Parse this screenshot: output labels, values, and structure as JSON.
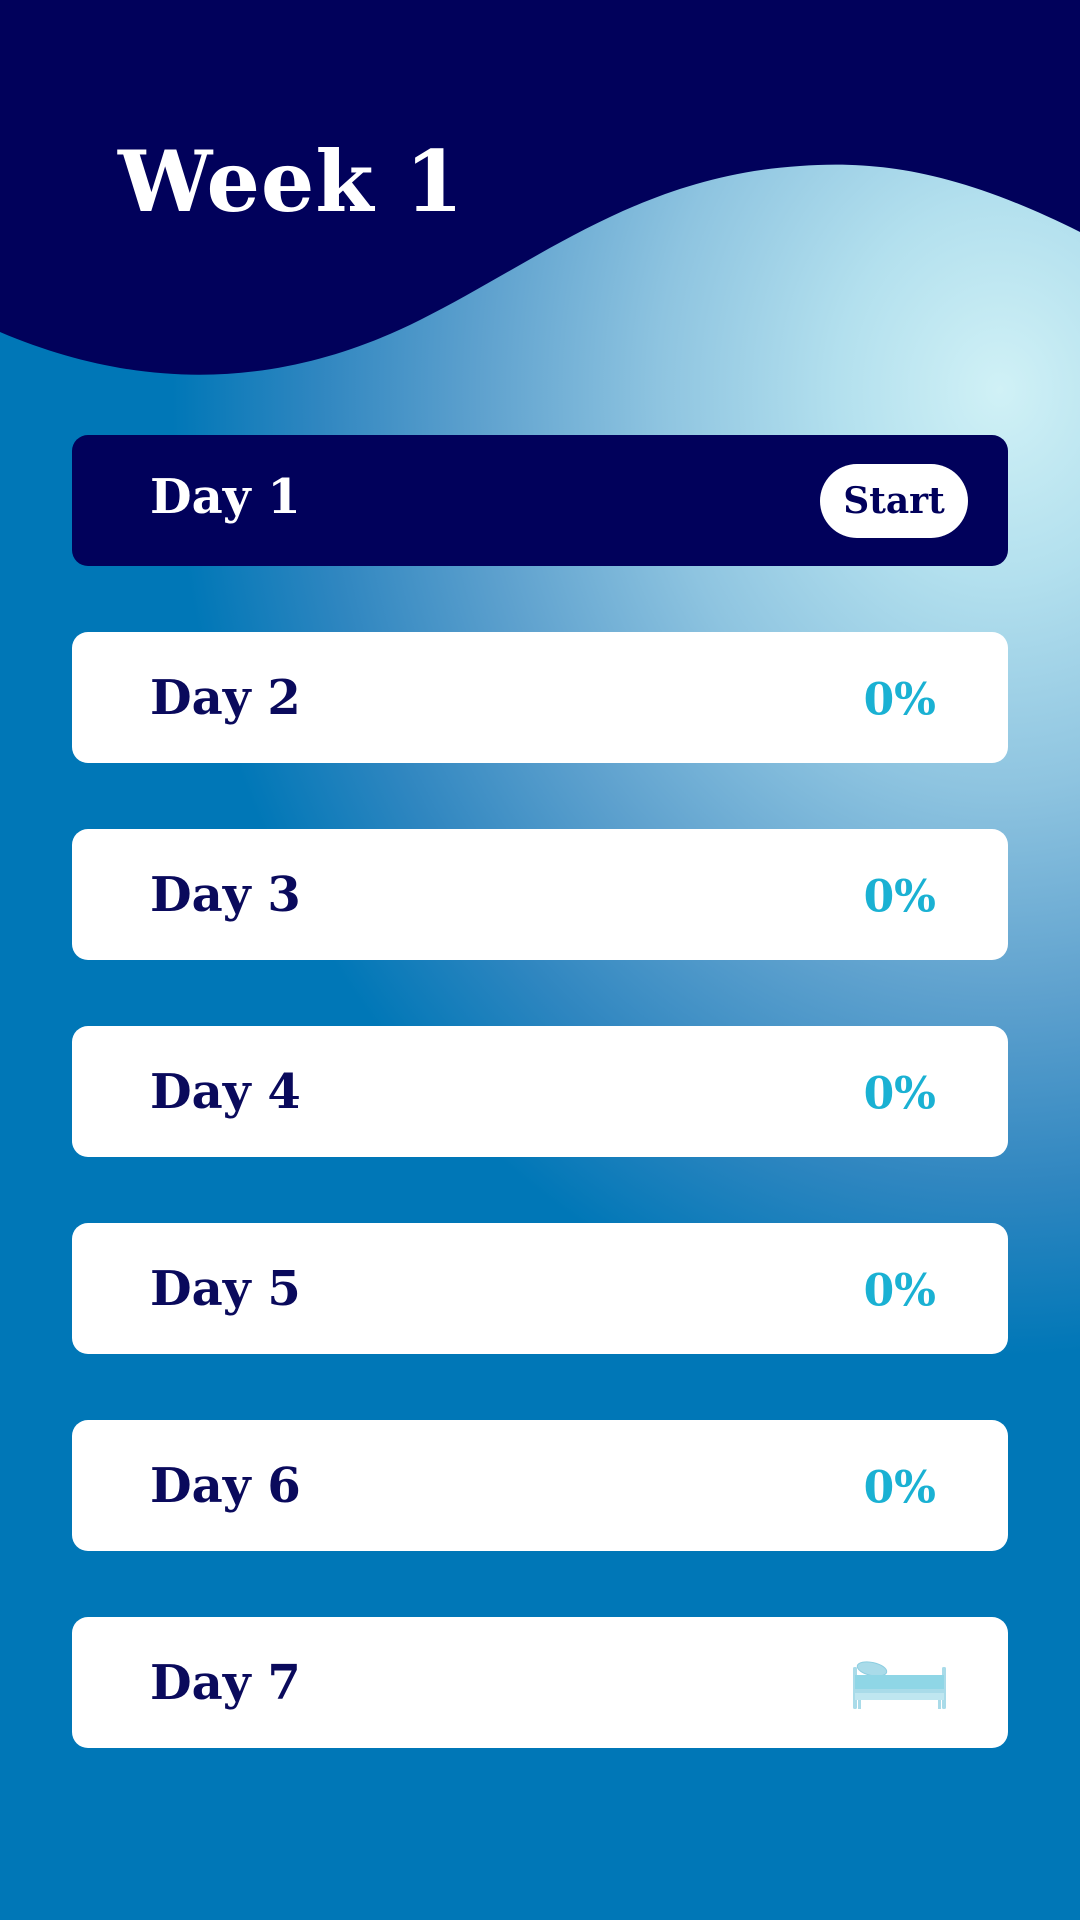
{
  "header": {
    "title": "Week 1"
  },
  "days": [
    {
      "label": "Day 1",
      "action_label": "Start"
    },
    {
      "label": "Day 2",
      "progress": "0%"
    },
    {
      "label": "Day 3",
      "progress": "0%"
    },
    {
      "label": "Day 4",
      "progress": "0%"
    },
    {
      "label": "Day 5",
      "progress": "0%"
    },
    {
      "label": "Day 6",
      "progress": "0%"
    },
    {
      "label": "Day 7",
      "icon": "bed-icon"
    }
  ],
  "colors": {
    "navy": "#01015b",
    "accent": "#1ab1d3",
    "background_deep": "#0077b7",
    "background_light": "#d0f1f6",
    "card": "#ffffff"
  }
}
